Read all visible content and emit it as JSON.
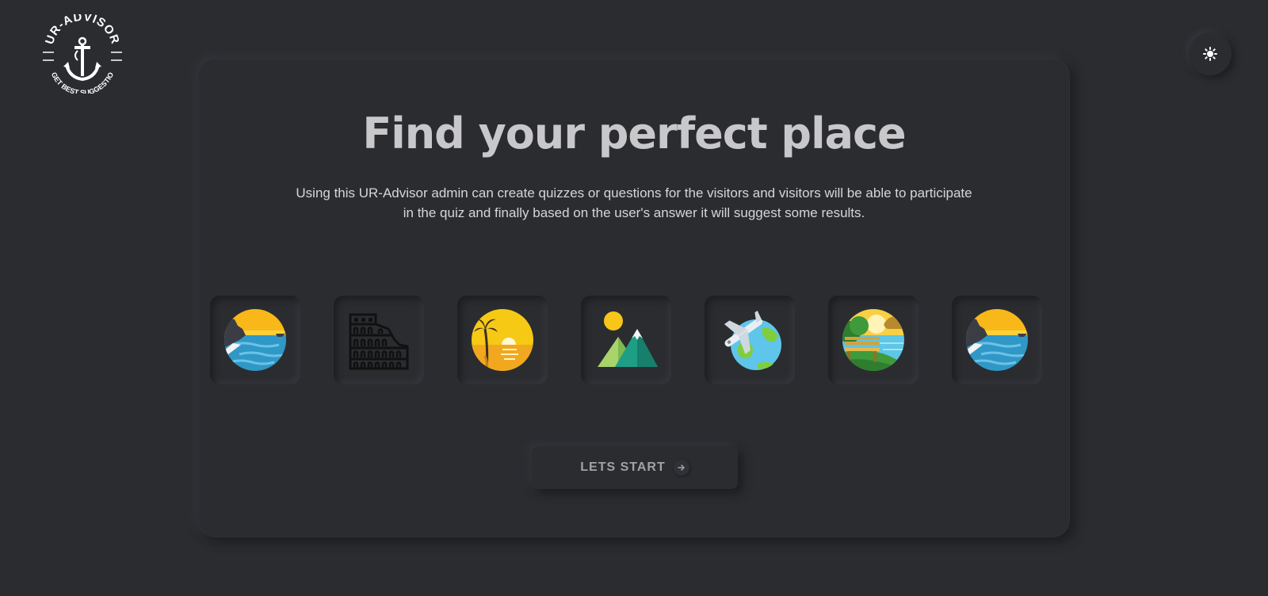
{
  "logo": {
    "brand_text": "UR-ADVISOR",
    "tagline": "GET BEST SUGGESTIO"
  },
  "theme_toggle": {
    "icon": "sun-icon"
  },
  "hero": {
    "title": "Find your perfect place",
    "description": "Using this UR-Advisor admin can create quizzes or questions for the visitors and visitors will be able to participate in the quiz and finally based on the user's answer it will suggest some results."
  },
  "destinations": [
    {
      "icon": "beach-cliff-icon"
    },
    {
      "icon": "colosseum-icon"
    },
    {
      "icon": "palm-sunset-icon"
    },
    {
      "icon": "mountain-icon"
    },
    {
      "icon": "airplane-globe-icon"
    },
    {
      "icon": "park-bench-icon"
    },
    {
      "icon": "beach-cliff-icon"
    }
  ],
  "cta": {
    "label": "LETS START",
    "icon": "arrow-right-icon"
  },
  "colors": {
    "background": "#2b2c30",
    "title": "#c8c8ca",
    "text": "#d6d6d8",
    "button_text": "#a2a2a6"
  }
}
